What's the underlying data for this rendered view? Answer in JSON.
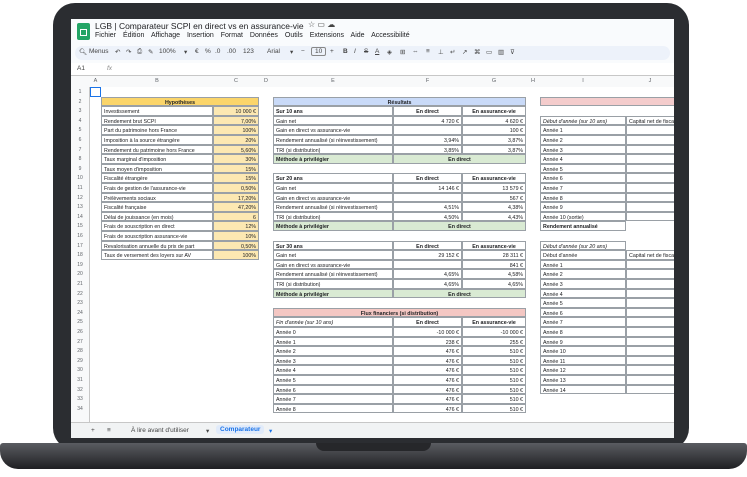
{
  "window": {
    "title": "LGB | Comparateur SCPI en direct vs en assurance-vie",
    "menu": [
      "Fichier",
      "Édition",
      "Affichage",
      "Insertion",
      "Format",
      "Données",
      "Outils",
      "Extensions",
      "Aide",
      "Accessibilité"
    ]
  },
  "toolbar": {
    "menus_label": "Menus",
    "zoom": "100%",
    "currency": "€",
    "percent": "%",
    "dec_dec": ".0",
    "dec_inc": ".00",
    "num_format": "123",
    "font": "Arial",
    "font_size": "10"
  },
  "formula_bar": {
    "cell_ref": "A1",
    "fx": "fx",
    "value": ""
  },
  "columns": [
    "A",
    "B",
    "C",
    "D",
    "E",
    "F",
    "G",
    "H",
    "I",
    "J"
  ],
  "rows": [
    "1",
    "2",
    "3",
    "4",
    "5",
    "6",
    "7",
    "8",
    "9",
    "10",
    "11",
    "12",
    "13",
    "14",
    "15",
    "16",
    "17",
    "18",
    "19",
    "20",
    "21",
    "22",
    "23",
    "24",
    "25",
    "26",
    "27",
    "28",
    "29",
    "30",
    "31",
    "32",
    "33",
    "34"
  ],
  "hypotheses": {
    "header": "Hypothèses",
    "rows": [
      [
        "Investissement",
        "10 000 €"
      ],
      [
        "Rendement brut SCPI",
        "7,00%"
      ],
      [
        "Part du patrimoine hors France",
        "100%"
      ],
      [
        "Imposition à la source étrangère",
        "20%"
      ],
      [
        "Rendement du patrimoine hors France",
        "5,60%"
      ],
      [
        "Taux marginal d'imposition",
        "30%"
      ],
      [
        "Taux moyen d'imposition",
        "15%"
      ],
      [
        "Fiscalité étrangère",
        "15%"
      ],
      [
        "Frais de gestion de l'assurance-vie",
        "0,50%"
      ],
      [
        "Prélèvements sociaux",
        "17,20%"
      ],
      [
        "Fiscalité française",
        "47,20%"
      ],
      [
        "Délai de jouissance (en mois)",
        "6"
      ],
      [
        "Frais de souscription en direct",
        "12%"
      ],
      [
        "Frais de souscription assurance-vie",
        "10%"
      ],
      [
        "Revalorisation annuelle du prix de part",
        "0,50%"
      ],
      [
        "Taux de versement des loyers sur AV",
        "100%"
      ]
    ]
  },
  "resultats": {
    "header": "Résultats",
    "col_direct": "En direct",
    "col_av": "En assurance-vie",
    "blocks": [
      {
        "title": "Sur 10 ans",
        "rows": [
          [
            "Gain net",
            "4 720 €",
            "4 620 €"
          ],
          [
            "Gain en direct vs assurance-vie",
            "",
            "100 €"
          ],
          [
            "Rendement annualisé (si réinvestissement)",
            "3,94%",
            "3,87%"
          ],
          [
            "TRI (si distribution)",
            "3,85%",
            "3,87%"
          ]
        ],
        "method": "Méthode à privilégier",
        "choice": "En direct"
      },
      {
        "title": "Sur 20 ans",
        "rows": [
          [
            "Gain net",
            "14 146 €",
            "13 579 €"
          ],
          [
            "Gain en direct vs assurance-vie",
            "",
            "567 €"
          ],
          [
            "Rendement annualisé (si réinvestissement)",
            "4,51%",
            "4,38%"
          ],
          [
            "TRI (si distribution)",
            "4,50%",
            "4,43%"
          ]
        ],
        "method": "Méthode à privilégier",
        "choice": "En direct"
      },
      {
        "title": "Sur 30 ans",
        "rows": [
          [
            "Gain net",
            "29 152 €",
            "28 311 €"
          ],
          [
            "Gain en direct vs assurance-vie",
            "",
            "841 €"
          ],
          [
            "Rendement annualisé (si réinvestissement)",
            "4,65%",
            "4,58%"
          ],
          [
            "TRI (si distribution)",
            "4,65%",
            "4,65%"
          ]
        ],
        "method": "Méthode à privilégier",
        "choice": "En direct"
      }
    ]
  },
  "flux": {
    "header": "Flux financiers (si distribution)",
    "subheader": "Fin d'année (sur 10 ans)",
    "col_direct": "En direct",
    "col_av": "En assurance-vie",
    "rows": [
      [
        "Année 0",
        "-10 000 €",
        "-10 000 €"
      ],
      [
        "Année 1",
        "238 €",
        "255 €"
      ],
      [
        "Année 2",
        "476 €",
        "510 €"
      ],
      [
        "Année 3",
        "476 €",
        "510 €"
      ],
      [
        "Année 4",
        "476 €",
        "510 €"
      ],
      [
        "Année 5",
        "476 €",
        "510 €"
      ],
      [
        "Année 6",
        "476 €",
        "510 €"
      ],
      [
        "Année 7",
        "476 €",
        "510 €"
      ],
      [
        "Année 8",
        "476 €",
        "510 €"
      ]
    ]
  },
  "right_table": {
    "head_10": "Début d'année (sur 10 ans)",
    "capital_10": "Capital net de fiscalit",
    "years_10": [
      "Année 1",
      "Année 2",
      "Année 3",
      "Année 4",
      "Année 5",
      "Année 6",
      "Année 7",
      "Année 8",
      "Année 9",
      "Année 10 (sortie)"
    ],
    "rendement": "Rendement annualisé",
    "head_20": "Début d'année (sur 20 ans)",
    "debut": "Début d'année",
    "capital_20": "Capital net de fiscalit",
    "years_20": [
      "Année 1",
      "Année 2",
      "Année 3",
      "Année 4",
      "Année 5",
      "Année 6",
      "Année 7",
      "Année 8",
      "Année 9",
      "Année 10",
      "Année 11",
      "Année 12",
      "Année 13",
      "Année 14"
    ]
  },
  "sheets": {
    "add": "+",
    "list": "≡",
    "tab1": "À lire avant d'utiliser",
    "tab2": "Comparateur"
  }
}
